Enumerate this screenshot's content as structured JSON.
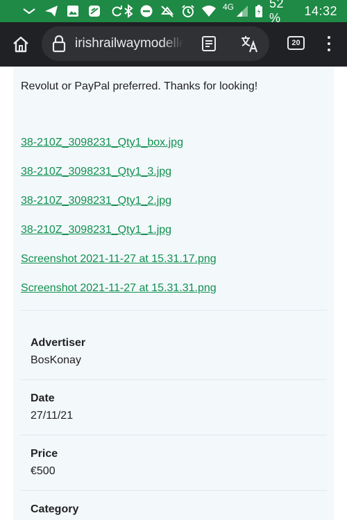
{
  "status_bar": {
    "network": "4G",
    "battery": "52 %",
    "time": "14:32"
  },
  "browser": {
    "url": "irishrailwaymodeller.com",
    "tab_count": "20"
  },
  "listing": {
    "description": "Revolut or PayPal preferred. Thanks for looking!",
    "attachments": [
      "38-210Z_3098231_Qty1_box.jpg",
      "38-210Z_3098231_Qty1_3.jpg",
      "38-210Z_3098231_Qty1_2.jpg",
      "38-210Z_3098231_Qty1_1.jpg",
      "Screenshot 2021-11-27 at 15.31.17.png",
      "Screenshot 2021-11-27 at 15.31.31.png"
    ],
    "details": {
      "advertiser_label": "Advertiser",
      "advertiser_value": "BosKonay",
      "date_label": "Date",
      "date_value": "27/11/21",
      "price_label": "Price",
      "price_value": "€500",
      "category_label": "Category"
    }
  },
  "colors": {
    "status_bar": "#1e8a45",
    "toolbar": "#202124",
    "link": "#10904f",
    "card": "#f3f8fb"
  }
}
